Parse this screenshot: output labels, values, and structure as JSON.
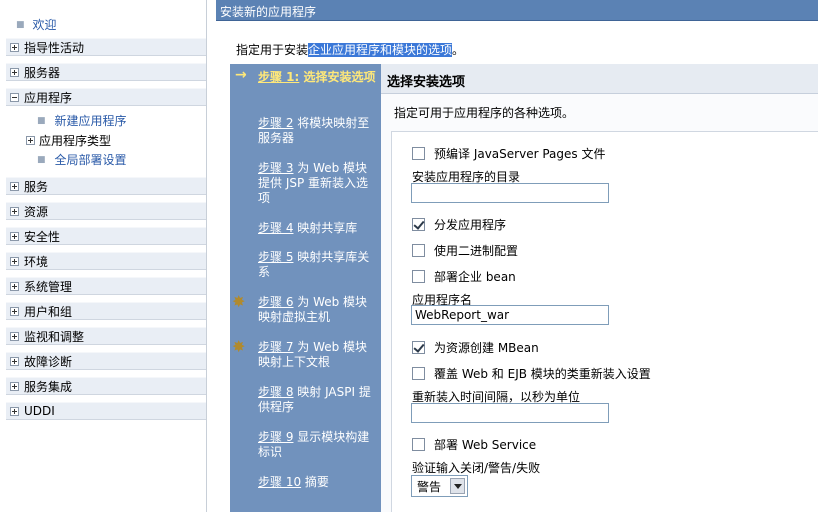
{
  "nav": {
    "welcome": "欢迎",
    "items": [
      {
        "label": "指导性活动"
      },
      {
        "label": "服务器"
      },
      {
        "label": "应用程序"
      },
      {
        "label": "服务"
      },
      {
        "label": "资源"
      },
      {
        "label": "安全性"
      },
      {
        "label": "环境"
      },
      {
        "label": "系统管理"
      },
      {
        "label": "用户和组"
      },
      {
        "label": "监视和调整"
      },
      {
        "label": "故障诊断"
      },
      {
        "label": "服务集成"
      },
      {
        "label": "UDDI"
      }
    ],
    "app_sub": {
      "new_app": "新建应用程序",
      "app_types": "应用程序类型",
      "global_deploy": "全局部署设置"
    }
  },
  "header": {
    "title": "安装新的应用程序",
    "instruction_prefix": "指定用于安装",
    "instruction_highlight": "企业应用程序和模块的选项",
    "instruction_suffix": "。"
  },
  "steps": [
    {
      "num": "步骤 1:",
      "text": " 选择安装选项"
    },
    {
      "num": "步骤 2",
      "text": " 将模块映射至服务器"
    },
    {
      "num": "步骤 3",
      "text": " 为 Web 模块提供 JSP 重新装入选项"
    },
    {
      "num": "步骤 4",
      "text": " 映射共享库"
    },
    {
      "num": "步骤 5",
      "text": " 映射共享库关系"
    },
    {
      "num": "步骤 6",
      "text": " 为 Web 模块映射虚拟主机"
    },
    {
      "num": "步骤 7",
      "text": " 为 Web 模块映射上下文根"
    },
    {
      "num": "步骤 8",
      "text": " 映射 JASPI 提供程序"
    },
    {
      "num": "步骤 9",
      "text": " 显示模块构建标识"
    },
    {
      "num": "步骤 10",
      "text": " 摘要"
    }
  ],
  "panel": {
    "title": "选择安装选项",
    "description": "指定可用于应用程序的各种选项。",
    "precompile_jsp": "预编译 JavaServer Pages 文件",
    "install_dir_label": "安装应用程序的目录",
    "install_dir_value": "",
    "distribute_app": "分发应用程序",
    "use_binary_config": "使用二进制配置",
    "deploy_ejb": "部署企业 bean",
    "app_name_label": "应用程序名",
    "app_name_value": "WebReport_war",
    "create_mbeans": "为资源创建 MBean",
    "override_reload": "覆盖 Web 和 EJB 模块的类重新装入设置",
    "reload_interval_label": "重新装入时间间隔，以秒为单位",
    "reload_interval_value": "",
    "deploy_webservice": "部署 Web Service",
    "validate_input_label": "验证输入关闭/警告/失败",
    "validate_input_value": "警告"
  }
}
